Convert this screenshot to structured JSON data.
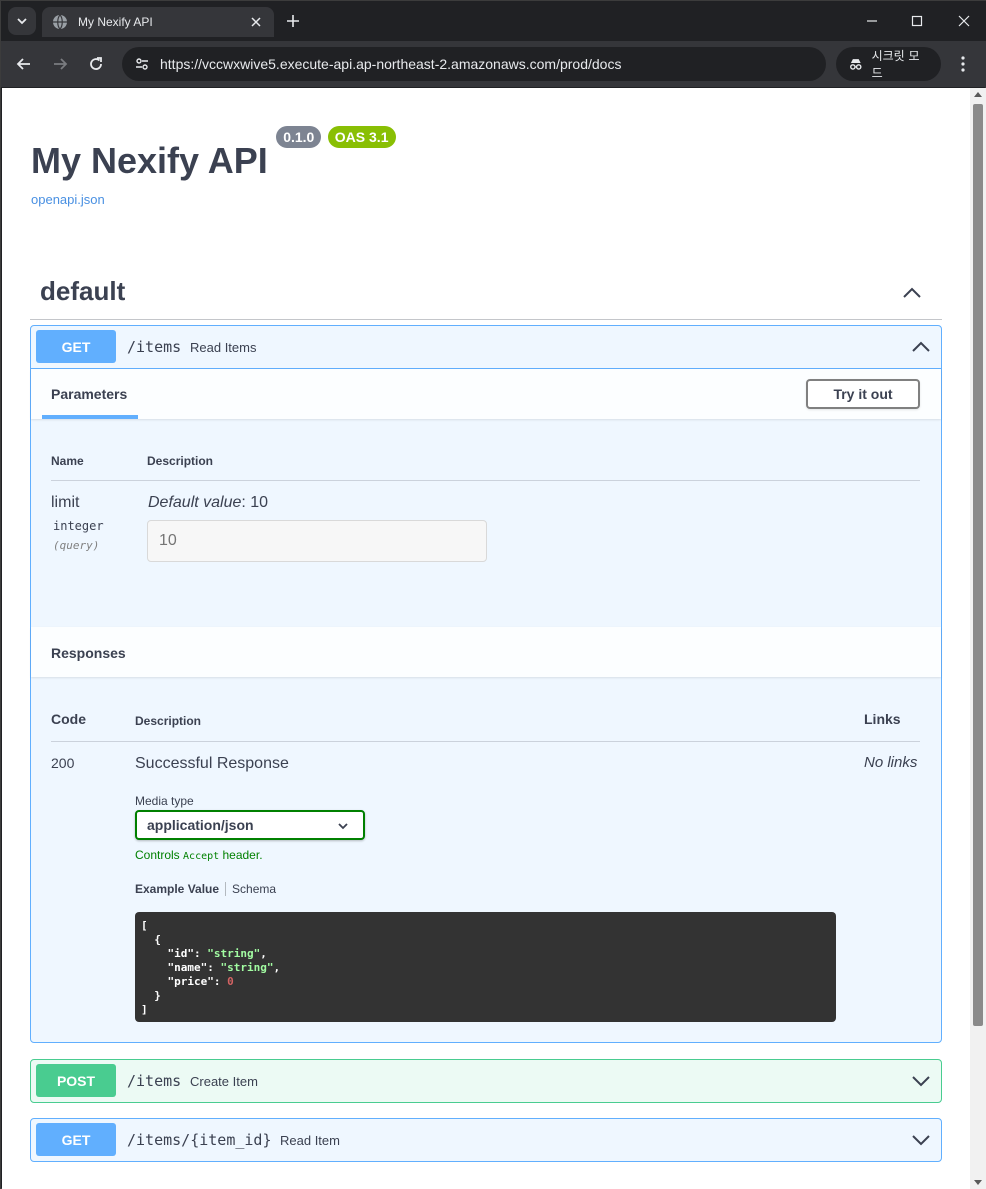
{
  "browser": {
    "tab_title": "My Nexify API",
    "url": "https://vccwxwive5.execute-api.ap-northeast-2.amazonaws.com/prod/docs",
    "incognito_label": "시크릿 모드"
  },
  "info": {
    "title": "My Nexify API",
    "version": "0.1.0",
    "oas": "OAS 3.1",
    "spec_link": "openapi.json"
  },
  "tag": {
    "name": "default"
  },
  "operations": [
    {
      "method": "GET",
      "path": "/items",
      "summary": "Read Items",
      "expanded": true
    },
    {
      "method": "POST",
      "path": "/items",
      "summary": "Create Item",
      "expanded": false
    },
    {
      "method": "GET",
      "path": "/items/{item_id}",
      "summary": "Read Item",
      "expanded": false
    }
  ],
  "parameters": {
    "tab_label": "Parameters",
    "try_button": "Try it out",
    "col_name": "Name",
    "col_description": "Description",
    "param": {
      "name": "limit",
      "type": "integer",
      "in": "(query)",
      "default_label": "Default value",
      "default_value": ": 10",
      "input_value": "10"
    }
  },
  "responses": {
    "title": "Responses",
    "col_code": "Code",
    "col_description": "Description",
    "col_links": "Links",
    "row": {
      "code": "200",
      "description": "Successful Response",
      "links": "No links",
      "media_type_label": "Media type",
      "media_type": "application/json",
      "controls_prefix": "Controls ",
      "controls_code": "Accept",
      "controls_suffix": " header.",
      "example_tab": "Example Value",
      "schema_tab": "Schema"
    },
    "example": {
      "open": "[",
      "obj_open": "  {",
      "id_key": "    \"id\": ",
      "id_val": "\"string\"",
      "name_key": "    \"name\": ",
      "name_val": "\"string\"",
      "price_key": "    \"price\": ",
      "price_val": "0",
      "obj_close": "  }",
      "close": "]"
    }
  },
  "colors": {
    "get": "#61affe",
    "post": "#49cc90",
    "badge_version": "#7d8492",
    "badge_oas": "#89bf04"
  }
}
